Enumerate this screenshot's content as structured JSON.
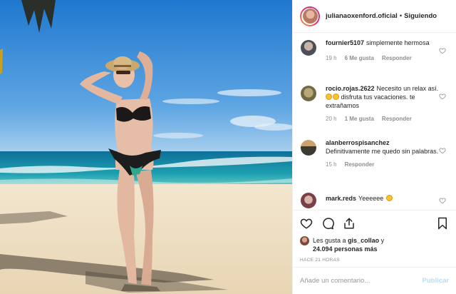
{
  "post": {
    "username": "julianaoxenford.oficial",
    "separator": "•",
    "follow_status": "Siguiendo"
  },
  "comments": [
    {
      "username": "fournier5107",
      "text": "simplemente hermosa",
      "time": "19 h",
      "likes": "6 Me gusta",
      "reply": "Responder"
    },
    {
      "username": "rocio.rojas.2622",
      "text_before": "Necesito un relax así.",
      "text_after": " disfruta tus vacaciones. te extrañamos",
      "time": "20 h",
      "likes": "1 Me gusta",
      "reply": "Responder"
    },
    {
      "username": "alanberrospisanchez",
      "text": "Definitivamente me quedo sin palabras.",
      "time": "15 h",
      "reply": "Responder"
    },
    {
      "username": "mark.reds",
      "text": "Yeeeeee"
    }
  ],
  "likes": {
    "prefix": "Les gusta a",
    "user": "gis_collao",
    "connector": "y",
    "count": "24.094 personas más"
  },
  "timestamp": "HACE 21 HORAS",
  "comment_input": {
    "placeholder": "Añade un comentario...",
    "value": ""
  },
  "publish_label": "Publicar",
  "colors": {
    "sky": "#2f86d4",
    "sea": "#1a8fa8",
    "sand": "#efe1c8",
    "publish_disabled": "#b2dffc",
    "meta_grey": "#8e8e8e"
  },
  "icons": [
    "heart-icon",
    "comment-icon",
    "share-icon",
    "bookmark-icon"
  ]
}
